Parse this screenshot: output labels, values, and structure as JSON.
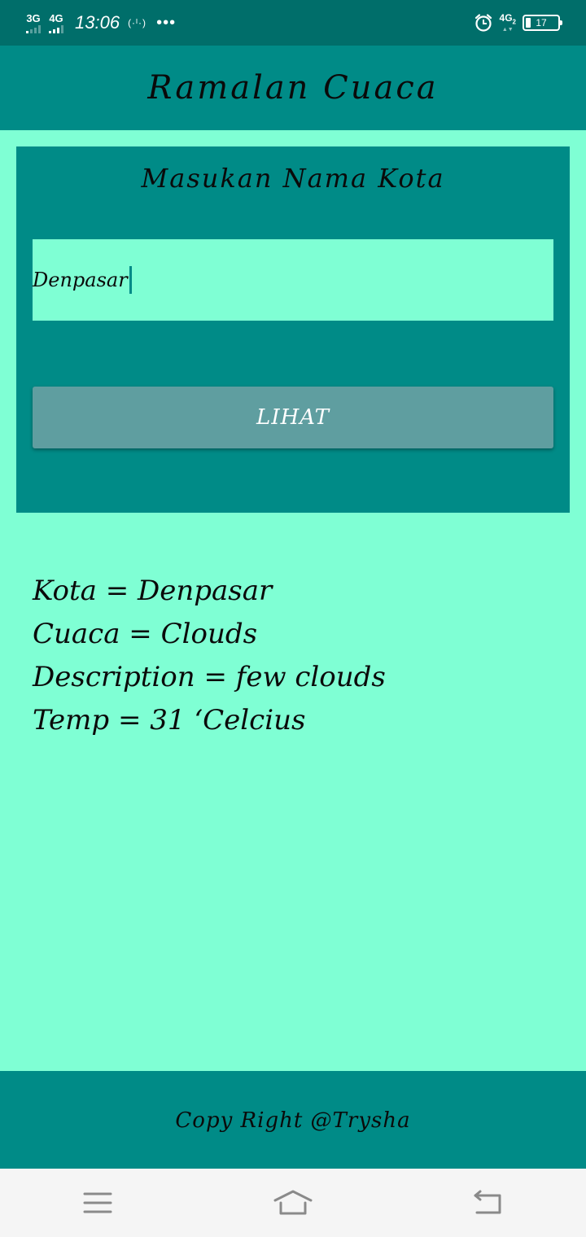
{
  "status_bar": {
    "network1": "3G",
    "network2": "4G",
    "time": "13:06",
    "hotspot": "(·ᴵ·)",
    "more": "•••",
    "network_right": "4G",
    "network_right_sub": "2",
    "battery": "17"
  },
  "app_bar": {
    "title": "Ramalan Cuaca"
  },
  "search_card": {
    "title": "Masukan Nama Kota",
    "city_input_value": "Denpasar",
    "button_label": "LIHAT"
  },
  "results": {
    "kota": "Kota = Denpasar",
    "cuaca": "Cuaca = Clouds",
    "description": "Description = few clouds",
    "temp": "Temp = 31 ‘Celcius"
  },
  "footer": {
    "text": "Copy Right @Trysha"
  },
  "nav_bar": {
    "menu_icon": "menu-icon",
    "home_icon": "home-icon",
    "back_icon": "back-icon"
  },
  "colors": {
    "status_bar": "#006e6a",
    "primary": "#008b87",
    "background": "#7fffd4",
    "button": "#5f9ea0"
  }
}
